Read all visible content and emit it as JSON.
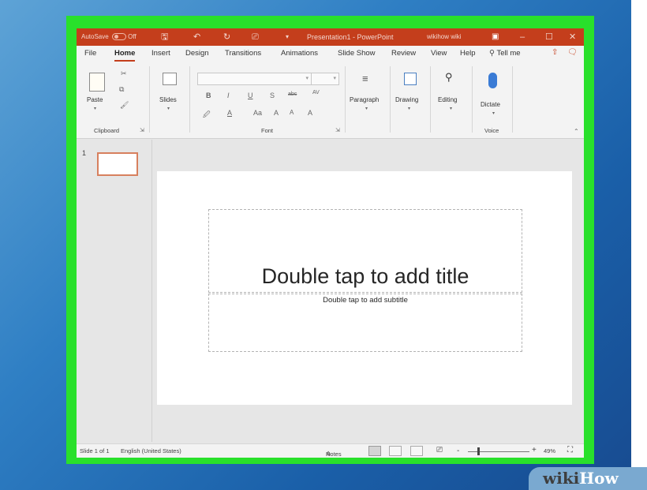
{
  "titlebar": {
    "autosave_label": "AutoSave",
    "autosave_state": "Off",
    "doc_title": "Presentation1  -  PowerPoint",
    "account": "wikihow wiki",
    "minimize": "–",
    "maximize": "☐",
    "close": "✕"
  },
  "tabs": [
    "File",
    "Home",
    "Insert",
    "Design",
    "Transitions",
    "Animations",
    "Slide Show",
    "Review",
    "View",
    "Help"
  ],
  "active_tab": "Home",
  "tell_me": "Tell me",
  "ribbon": {
    "clipboard": {
      "paste": "Paste",
      "group_label": "Clipboard"
    },
    "slides": {
      "label": "Slides"
    },
    "font": {
      "group_label": "Font",
      "bold": "B",
      "italic": "I",
      "underline": "U",
      "strike": "S",
      "abc": "abc",
      "spacing": "AV",
      "highlight": "A",
      "font_color": "A",
      "change_case": "Aa",
      "grow": "A",
      "shrink": "A",
      "clear": "A"
    },
    "paragraph": {
      "label": "Paragraph"
    },
    "drawing": {
      "label": "Drawing"
    },
    "editing": {
      "label": "Editing"
    },
    "voice": {
      "dictate": "Dictate",
      "group_label": "Voice"
    }
  },
  "thumbnail": {
    "number": "1"
  },
  "slide": {
    "title_placeholder": "Double tap to add title",
    "subtitle_placeholder": "Double tap to add subtitle"
  },
  "statusbar": {
    "slide_info": "Slide 1 of 1",
    "language": "English (United States)",
    "notes": "Notes",
    "zoom_minus": "-",
    "zoom_plus": "+",
    "zoom_level": "49%"
  },
  "watermark": {
    "part1": "wiki",
    "part2": "How"
  },
  "colors": {
    "accent": "#c43e1c",
    "highlight_frame": "#29e02b",
    "desktop": "#2f7fc4"
  }
}
